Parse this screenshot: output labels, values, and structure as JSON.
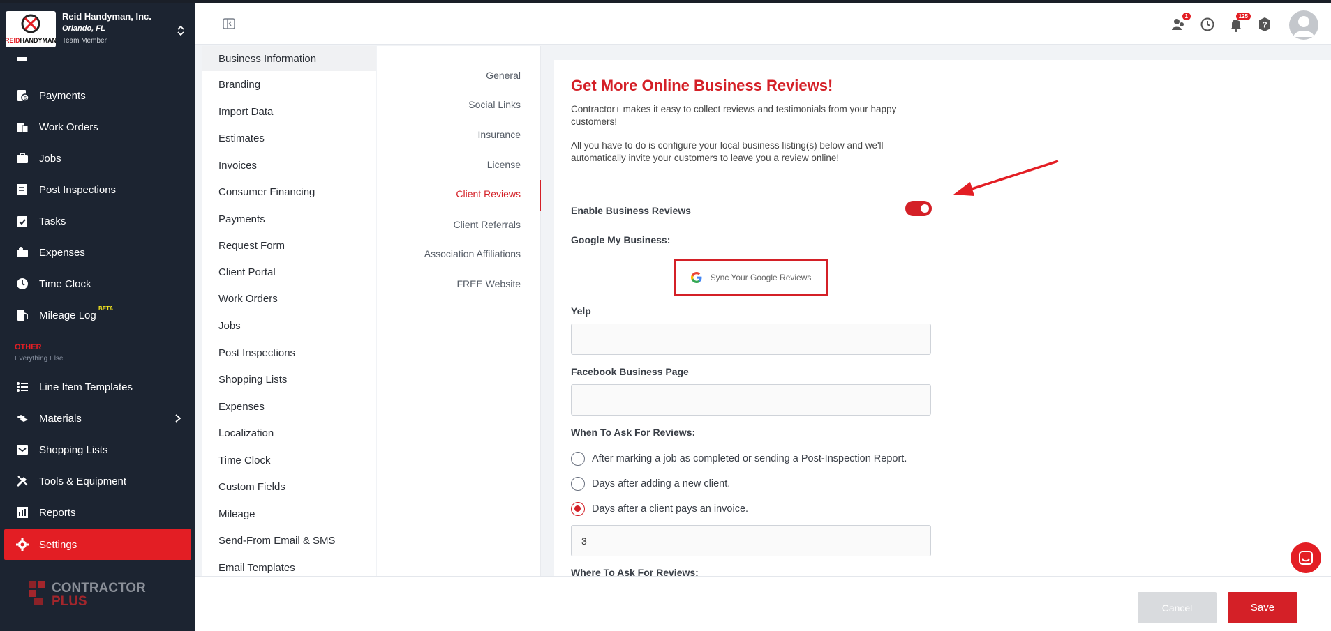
{
  "company": {
    "name": "Reid Handyman, Inc.",
    "location": "Orlando, FL",
    "role": "Team Member",
    "logo_text": "REIDHANDYMAN"
  },
  "sidebar": {
    "items": [
      {
        "label": "Payments",
        "icon": "payments-icon"
      },
      {
        "label": "Work Orders",
        "icon": "work-orders-icon"
      },
      {
        "label": "Jobs",
        "icon": "briefcase-icon"
      },
      {
        "label": "Post Inspections",
        "icon": "inspection-icon"
      },
      {
        "label": "Tasks",
        "icon": "clipboard-icon"
      },
      {
        "label": "Expenses",
        "icon": "wallet-icon"
      },
      {
        "label": "Time Clock",
        "icon": "clock-icon"
      },
      {
        "label": "Mileage Log",
        "icon": "fuel-icon"
      },
      {
        "label": "Line Item Templates",
        "icon": "list-icon"
      },
      {
        "label": "Materials",
        "icon": "materials-icon"
      },
      {
        "label": "Shopping Lists",
        "icon": "cart-icon"
      },
      {
        "label": "Tools & Equipment",
        "icon": "tools-icon"
      },
      {
        "label": "Reports",
        "icon": "chart-icon"
      },
      {
        "label": "Settings",
        "icon": "gear-icon"
      }
    ],
    "beta_label": "BETA",
    "other_heading": "OTHER",
    "other_sub": "Everything Else",
    "brand_line1": "CONTRACTOR",
    "brand_line2": "PLUS"
  },
  "topbar": {
    "team_badge": "1",
    "notif_badge": "125"
  },
  "settings_menu": [
    "Business Information",
    "Branding",
    "Import Data",
    "Estimates",
    "Invoices",
    "Consumer Financing",
    "Payments",
    "Request Form",
    "Client Portal",
    "Work Orders",
    "Jobs",
    "Post Inspections",
    "Shopping Lists",
    "Expenses",
    "Localization",
    "Time Clock",
    "Custom Fields",
    "Mileage",
    "Send-From Email & SMS",
    "Email Templates"
  ],
  "subtabs": [
    "General",
    "Social Links",
    "Insurance",
    "License",
    "Client Reviews",
    "Client Referrals",
    "Association Affiliations",
    "FREE Website"
  ],
  "content": {
    "title": "Get More Online Business Reviews!",
    "intro1": "Contractor+ makes it easy to collect reviews and testimonials from your happy customers!",
    "intro2": "All you have to do is configure your local business listing(s) below and we'll automatically invite your customers to leave you a review online!",
    "enable_label": "Enable Business Reviews",
    "google_label": "Google My Business:",
    "google_button": "Sync Your Google Reviews",
    "yelp_label": "Yelp",
    "yelp_value": "",
    "facebook_label": "Facebook Business Page",
    "facebook_value": "",
    "when_label": "When To Ask For Reviews:",
    "when_options": [
      "After marking a job as completed or sending a Post-Inspection Report.",
      "Days after adding a new client.",
      "Days after a client pays an invoice."
    ],
    "selected_option": 2,
    "days_value": "3",
    "where_label": "Where To Ask For Reviews:"
  },
  "footer": {
    "cancel": "Cancel",
    "save": "Save"
  },
  "colors": {
    "accent": "#d42027",
    "sidebar_bg": "#1c2431"
  }
}
